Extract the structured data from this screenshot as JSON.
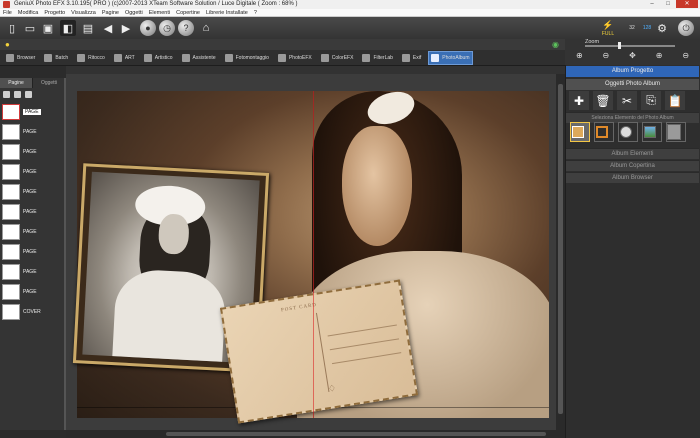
{
  "window": {
    "title": "GeniuX Photo EFX 3.10.195( PRO ) (c)2007-2013 XTeam Software Solution / Luce Digitale ( Zoom : 68% )",
    "minimize": "–",
    "maximize": "□",
    "close": "✕"
  },
  "menu": [
    "File",
    "Modifica",
    "Progetto",
    "Visualizza",
    "Pagine",
    "Oggetti",
    "Elementi",
    "Copertine",
    "Librerie Installate",
    "?"
  ],
  "toolbar_badges": {
    "full": "FULL",
    "left_num": "32",
    "right_num": "128"
  },
  "tools": [
    {
      "label": "Browser"
    },
    {
      "label": "Batch"
    },
    {
      "label": "Ritocco"
    },
    {
      "label": "ART"
    },
    {
      "label": "Artistico"
    },
    {
      "label": "Assistente"
    },
    {
      "label": "Fotomontaggio"
    },
    {
      "label": "PhotoEFX"
    },
    {
      "label": "ColorEFX"
    },
    {
      "label": "FilterLab"
    },
    {
      "label": "Exif"
    },
    {
      "label": "PhotoAlbum",
      "active": true
    }
  ],
  "left_panel": {
    "tabs": [
      "Pagine",
      "Oggetti"
    ],
    "pages": [
      "PAGE",
      "PAGE",
      "PAGE",
      "PAGE",
      "PAGE",
      "PAGE",
      "PAGE",
      "PAGE",
      "PAGE",
      "PAGE",
      "COVER"
    ]
  },
  "postcard": {
    "title": "POST CARD"
  },
  "right_panel": {
    "zoom_label": "Zoom",
    "zoom_icons": [
      "⊕",
      "⊖",
      "✥",
      "⊕",
      "⊖"
    ],
    "project_header": "Album Progetto",
    "objects_header": "Oggetti Photo Album",
    "object_icons": [
      "✚",
      "🗑",
      "✂",
      "⎘",
      "📋"
    ],
    "select_header": "Seleziona Elemento del Photo Album",
    "sections": [
      "Album Elementi",
      "Album Copertina",
      "Album Browser"
    ]
  }
}
